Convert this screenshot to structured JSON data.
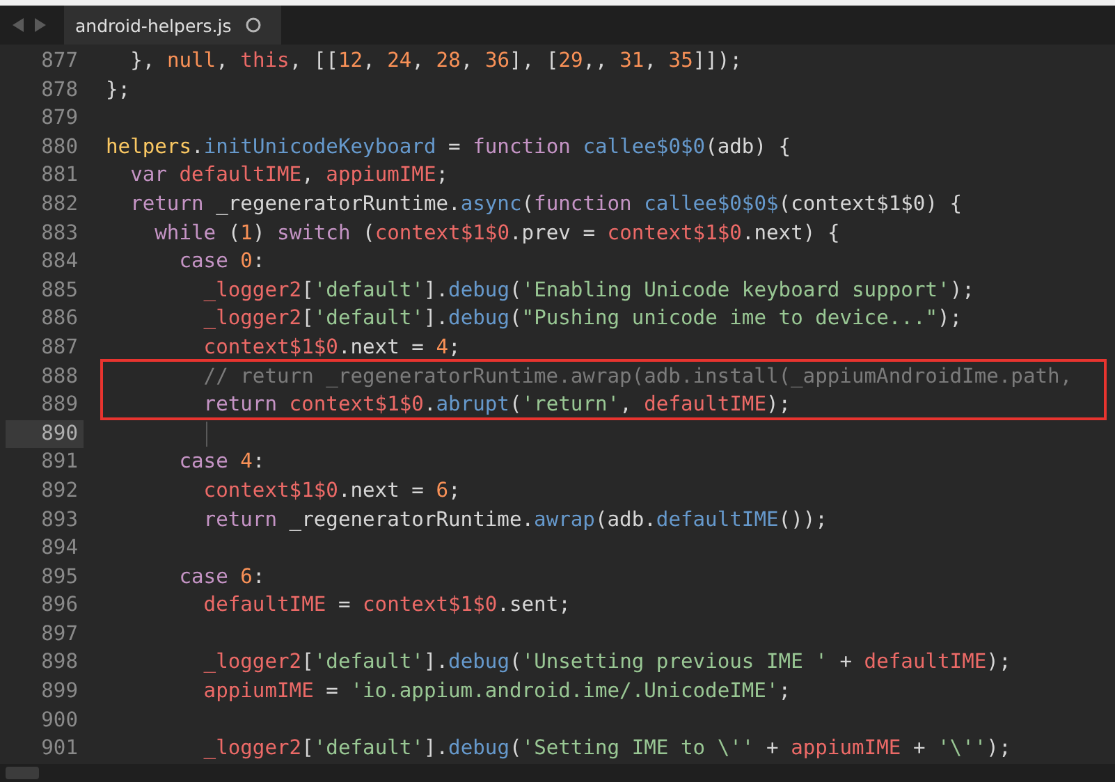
{
  "tabs": [
    {
      "label": "android-helpers.js",
      "selected": true,
      "modified": true
    }
  ],
  "lines": [
    {
      "number": "877",
      "current": false,
      "tokens": [
        {
          "kind": "plain",
          "text": "  }, "
        },
        {
          "kind": "number",
          "text": "null"
        },
        {
          "kind": "plain",
          "text": ", "
        },
        {
          "kind": "variable",
          "text": "this"
        },
        {
          "kind": "plain",
          "text": ", [["
        },
        {
          "kind": "number",
          "text": "12"
        },
        {
          "kind": "plain",
          "text": ", "
        },
        {
          "kind": "number",
          "text": "24"
        },
        {
          "kind": "plain",
          "text": ", "
        },
        {
          "kind": "number",
          "text": "28"
        },
        {
          "kind": "plain",
          "text": ", "
        },
        {
          "kind": "number",
          "text": "36"
        },
        {
          "kind": "plain",
          "text": "], ["
        },
        {
          "kind": "number",
          "text": "29"
        },
        {
          "kind": "plain",
          "text": ",, "
        },
        {
          "kind": "number",
          "text": "31"
        },
        {
          "kind": "plain",
          "text": ", "
        },
        {
          "kind": "number",
          "text": "35"
        },
        {
          "kind": "plain",
          "text": "]]);"
        }
      ]
    },
    {
      "number": "878",
      "current": false,
      "tokens": [
        {
          "kind": "plain",
          "text": "};"
        }
      ]
    },
    {
      "number": "879",
      "current": false
    },
    {
      "number": "880",
      "current": false,
      "tokens": [
        {
          "kind": "object",
          "text": "helpers"
        },
        {
          "kind": "plain",
          "text": "."
        },
        {
          "kind": "function",
          "text": "initUnicodeKeyboard"
        },
        {
          "kind": "plain",
          "text": " = "
        },
        {
          "kind": "keyword",
          "text": "function"
        },
        {
          "kind": "function",
          "text": " callee$0$0"
        },
        {
          "kind": "plain",
          "text": "(adb) {"
        }
      ]
    },
    {
      "number": "881",
      "current": false,
      "tokens": [
        {
          "kind": "keyword",
          "text": "  var"
        },
        {
          "kind": "variable",
          "text": " defaultIME"
        },
        {
          "kind": "plain",
          "text": ", "
        },
        {
          "kind": "variable",
          "text": "appiumIME"
        },
        {
          "kind": "plain",
          "text": ";"
        }
      ]
    },
    {
      "number": "882",
      "current": false,
      "tokens": [
        {
          "kind": "keyword",
          "text": "  return"
        },
        {
          "kind": "plain",
          "text": " _regeneratorRuntime."
        },
        {
          "kind": "function",
          "text": "async"
        },
        {
          "kind": "plain",
          "text": "("
        },
        {
          "kind": "keyword",
          "text": "function"
        },
        {
          "kind": "function",
          "text": " callee$0$0$"
        },
        {
          "kind": "plain",
          "text": "(context$1$0) {"
        }
      ]
    },
    {
      "number": "883",
      "current": false,
      "tokens": [
        {
          "kind": "keyword",
          "text": "    while"
        },
        {
          "kind": "plain",
          "text": " ("
        },
        {
          "kind": "number",
          "text": "1"
        },
        {
          "kind": "plain",
          "text": ") "
        },
        {
          "kind": "keyword",
          "text": "switch"
        },
        {
          "kind": "plain",
          "text": " ("
        },
        {
          "kind": "variable",
          "text": "context$1$0"
        },
        {
          "kind": "plain",
          "text": ".prev = "
        },
        {
          "kind": "variable",
          "text": "context$1$0"
        },
        {
          "kind": "plain",
          "text": ".next) {"
        }
      ]
    },
    {
      "number": "884",
      "current": false,
      "tokens": [
        {
          "kind": "keyword",
          "text": "      case"
        },
        {
          "kind": "number",
          "text": " 0"
        },
        {
          "kind": "plain",
          "text": ":"
        }
      ]
    },
    {
      "number": "885",
      "current": false,
      "tokens": [
        {
          "kind": "variable",
          "text": "        _logger2"
        },
        {
          "kind": "plain",
          "text": "["
        },
        {
          "kind": "string",
          "text": "'default'"
        },
        {
          "kind": "plain",
          "text": "]."
        },
        {
          "kind": "function",
          "text": "debug"
        },
        {
          "kind": "plain",
          "text": "("
        },
        {
          "kind": "string",
          "text": "'Enabling Unicode keyboard support'"
        },
        {
          "kind": "plain",
          "text": ");"
        }
      ]
    },
    {
      "number": "886",
      "current": false,
      "tokens": [
        {
          "kind": "variable",
          "text": "        _logger2"
        },
        {
          "kind": "plain",
          "text": "["
        },
        {
          "kind": "string",
          "text": "'default'"
        },
        {
          "kind": "plain",
          "text": "]."
        },
        {
          "kind": "function",
          "text": "debug"
        },
        {
          "kind": "plain",
          "text": "("
        },
        {
          "kind": "string",
          "text": "\"Pushing unicode ime to device...\""
        },
        {
          "kind": "plain",
          "text": ");"
        }
      ]
    },
    {
      "number": "887",
      "current": false,
      "tokens": [
        {
          "kind": "variable",
          "text": "        context$1$0"
        },
        {
          "kind": "plain",
          "text": ".next = "
        },
        {
          "kind": "number",
          "text": "4"
        },
        {
          "kind": "plain",
          "text": ";"
        }
      ]
    },
    {
      "number": "888",
      "current": false,
      "tokens": [
        {
          "kind": "comment",
          "text": "        // return _regeneratorRuntime.awrap(adb.install(_appiumAndroidIme.path,"
        }
      ]
    },
    {
      "number": "889",
      "current": false,
      "tokens": [
        {
          "kind": "keyword",
          "text": "        return"
        },
        {
          "kind": "variable",
          "text": " context$1$0"
        },
        {
          "kind": "plain",
          "text": "."
        },
        {
          "kind": "function",
          "text": "abrupt"
        },
        {
          "kind": "plain",
          "text": "("
        },
        {
          "kind": "string",
          "text": "'return'"
        },
        {
          "kind": "plain",
          "text": ", "
        },
        {
          "kind": "variable",
          "text": "defaultIME"
        },
        {
          "kind": "plain",
          "text": ");"
        }
      ]
    },
    {
      "number": "890",
      "current": true
    },
    {
      "number": "891",
      "current": false,
      "tokens": [
        {
          "kind": "keyword",
          "text": "      case"
        },
        {
          "kind": "number",
          "text": " 4"
        },
        {
          "kind": "plain",
          "text": ":"
        }
      ]
    },
    {
      "number": "892",
      "current": false,
      "tokens": [
        {
          "kind": "variable",
          "text": "        context$1$0"
        },
        {
          "kind": "plain",
          "text": ".next = "
        },
        {
          "kind": "number",
          "text": "6"
        },
        {
          "kind": "plain",
          "text": ";"
        }
      ]
    },
    {
      "number": "893",
      "current": false,
      "tokens": [
        {
          "kind": "keyword",
          "text": "        return"
        },
        {
          "kind": "plain",
          "text": " _regeneratorRuntime."
        },
        {
          "kind": "function",
          "text": "awrap"
        },
        {
          "kind": "plain",
          "text": "(adb."
        },
        {
          "kind": "function",
          "text": "defaultIME"
        },
        {
          "kind": "plain",
          "text": "());"
        }
      ]
    },
    {
      "number": "894",
      "current": false
    },
    {
      "number": "895",
      "current": false,
      "tokens": [
        {
          "kind": "keyword",
          "text": "      case"
        },
        {
          "kind": "number",
          "text": " 6"
        },
        {
          "kind": "plain",
          "text": ":"
        }
      ]
    },
    {
      "number": "896",
      "current": false,
      "tokens": [
        {
          "kind": "variable",
          "text": "        defaultIME"
        },
        {
          "kind": "plain",
          "text": " = "
        },
        {
          "kind": "variable",
          "text": "context$1$0"
        },
        {
          "kind": "plain",
          "text": ".sent;"
        }
      ]
    },
    {
      "number": "897",
      "current": false
    },
    {
      "number": "898",
      "current": false,
      "tokens": [
        {
          "kind": "variable",
          "text": "        _logger2"
        },
        {
          "kind": "plain",
          "text": "["
        },
        {
          "kind": "string",
          "text": "'default'"
        },
        {
          "kind": "plain",
          "text": "]."
        },
        {
          "kind": "function",
          "text": "debug"
        },
        {
          "kind": "plain",
          "text": "("
        },
        {
          "kind": "string",
          "text": "'Unsetting previous IME '"
        },
        {
          "kind": "plain",
          "text": " + "
        },
        {
          "kind": "variable",
          "text": "defaultIME"
        },
        {
          "kind": "plain",
          "text": ");"
        }
      ]
    },
    {
      "number": "899",
      "current": false,
      "tokens": [
        {
          "kind": "variable",
          "text": "        appiumIME"
        },
        {
          "kind": "plain",
          "text": " = "
        },
        {
          "kind": "string",
          "text": "'io.appium.android.ime/.UnicodeIME'"
        },
        {
          "kind": "plain",
          "text": ";"
        }
      ]
    },
    {
      "number": "900",
      "current": false
    },
    {
      "number": "901",
      "current": false,
      "tokens": [
        {
          "kind": "variable",
          "text": "        _logger2"
        },
        {
          "kind": "plain",
          "text": "["
        },
        {
          "kind": "string",
          "text": "'default'"
        },
        {
          "kind": "plain",
          "text": "]."
        },
        {
          "kind": "function",
          "text": "debug"
        },
        {
          "kind": "plain",
          "text": "("
        },
        {
          "kind": "string",
          "text": "'Setting IME to \\''"
        },
        {
          "kind": "plain",
          "text": " + "
        },
        {
          "kind": "variable",
          "text": "appiumIME"
        },
        {
          "kind": "plain",
          "text": " + "
        },
        {
          "kind": "string",
          "text": "'\\''"
        },
        {
          "kind": "plain",
          "text": ");"
        }
      ]
    }
  ]
}
